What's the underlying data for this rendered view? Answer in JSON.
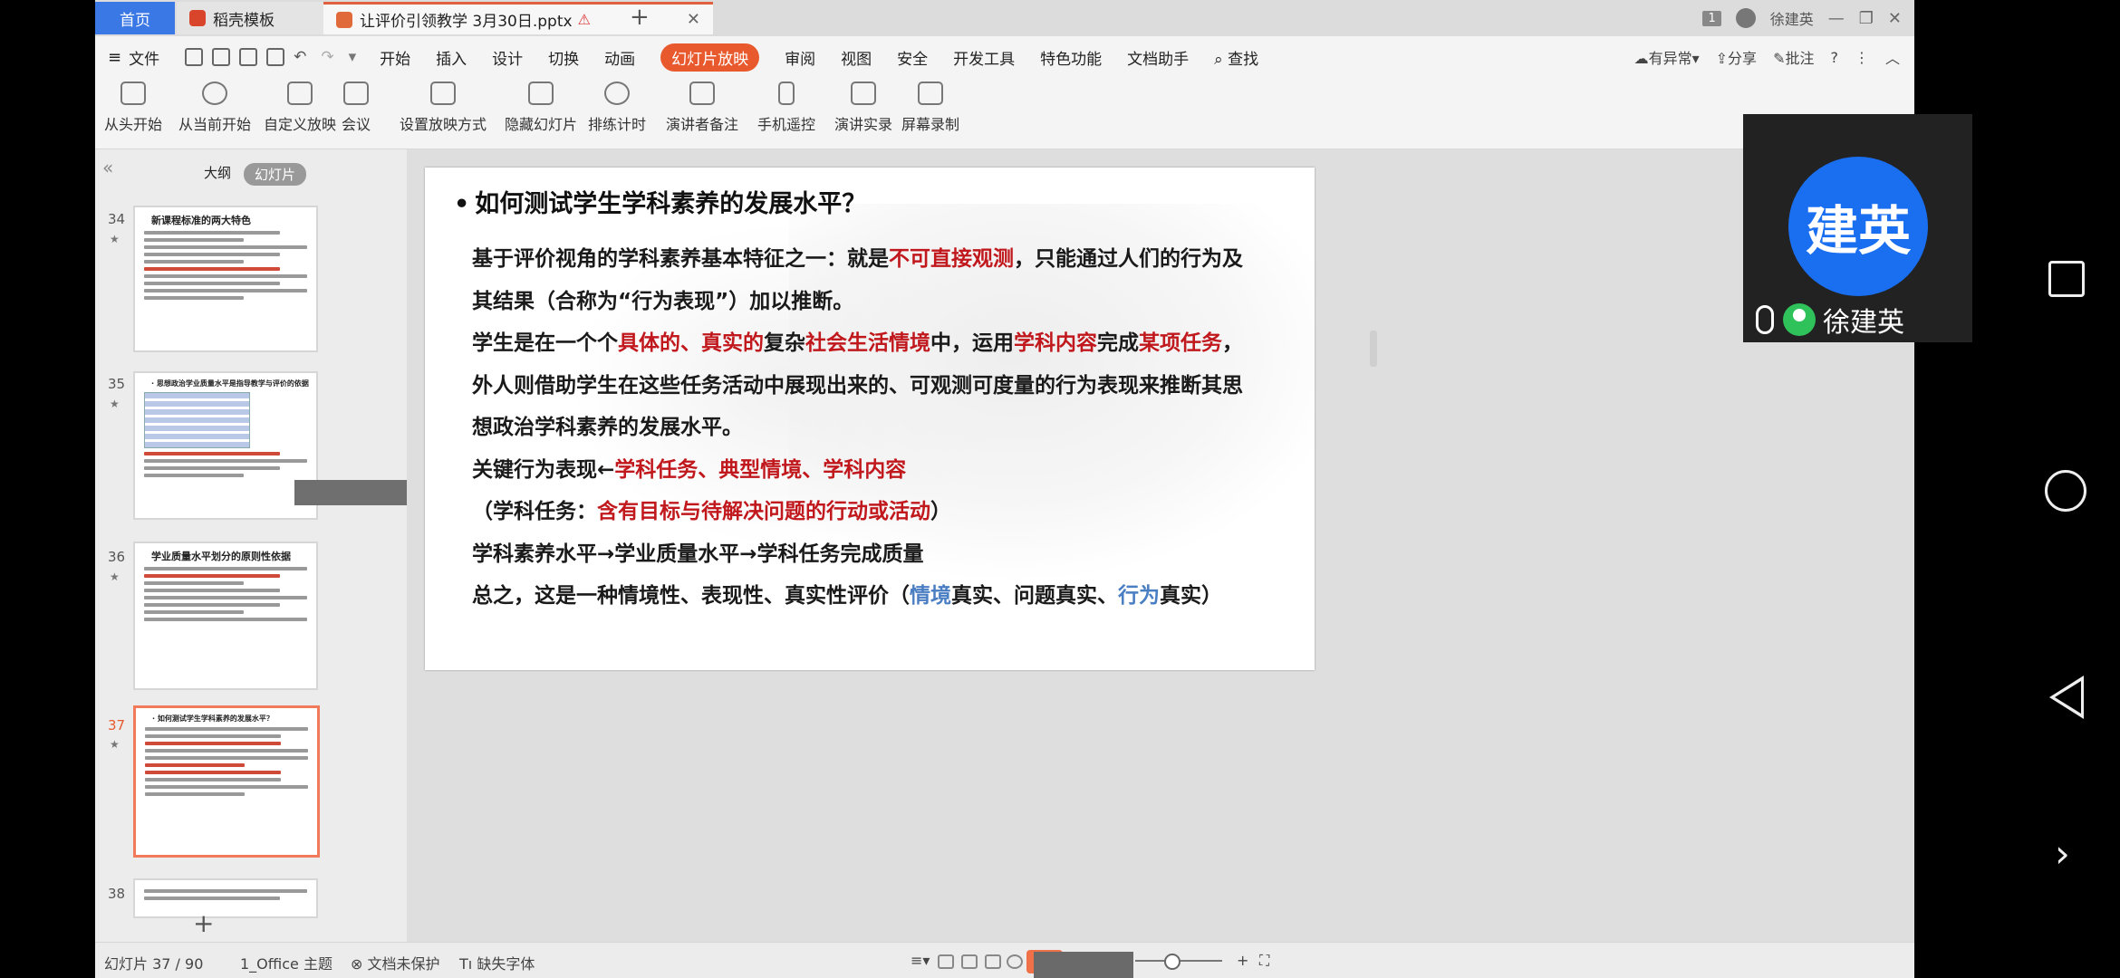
{
  "titlebar": {
    "tab_home": "首页",
    "tab_template": "稻壳模板",
    "tab_document": "让评价引领教学   3月30日.pptx",
    "warning": "⚠",
    "close": "✕",
    "new_tab": "+",
    "page_badge": "1",
    "user": "徐建英",
    "minimize": "—",
    "restore": "❐",
    "close_window": "✕"
  },
  "menu": {
    "file": "文件",
    "items": [
      "开始",
      "插入",
      "设计",
      "切换",
      "动画",
      "幻灯片放映",
      "审阅",
      "视图",
      "安全",
      "开发工具",
      "特色功能",
      "文档助手"
    ],
    "active_index": 5,
    "search": "查找",
    "right": [
      "有异常",
      "分享",
      "批注"
    ]
  },
  "ribbon": {
    "buttons": [
      "从头开始",
      "从当前开始",
      "自定义放映",
      "会议",
      "设置放映方式",
      "隐藏幻灯片",
      "排练计时",
      "演讲者备注",
      "手机遥控",
      "演讲实录",
      "屏幕录制"
    ]
  },
  "pane": {
    "tab_outline": "大纲",
    "tab_slides": "幻灯片",
    "thumbs": [
      {
        "num": "34",
        "title": "新课程标准的两大特色"
      },
      {
        "num": "35",
        "title": "· 思想政治学业质量水平是指导教学与评价的依据"
      },
      {
        "num": "36",
        "title": "学业质量水平划分的原则性依据"
      },
      {
        "num": "37",
        "title": "· 如何测试学生学科素养的发展水平？"
      },
      {
        "num": "38",
        "title": ""
      }
    ]
  },
  "slide": {
    "title": "如何测试学生学科素养的发展水平？",
    "p1a": "基于评价视角的学科素养基本特征之一：就是",
    "p1_red": "不可直接观测",
    "p1b": "，只能通过人们的行为及其结果（合称为“行为表现”）加以推断。",
    "p2a": "学生是在一个个",
    "p2_red1": "具体的、真实的",
    "p2b": "复杂",
    "p2_red2": "社会生活情境",
    "p2c": "中，运用",
    "p2_red3": "学科内容",
    "p2d": "完成",
    "p2_red4": "某项任务",
    "p2e": "，外人则借助学生在这些任务活动中展现出来的、可观测可度量的行为表现来推断其思想政治学科素养的发展水平。",
    "p3a": "关键行为表现←",
    "p3_red": "学科任务、典型情境、学科内容",
    "p4a": "（学科任务：",
    "p4_red": "含有目标与待解决问题的行动或活动",
    "p4b": "）",
    "p5": "学科素养水平→学业质量水平→学科任务完成质量",
    "p6a": "总之，这是一种情境性、表现性、真实性评价（",
    "p6_blue1": "情境",
    "p6b": "真实、问题真实、",
    "p6_blue2": "行为",
    "p6c": "真实）"
  },
  "status": {
    "slide_count": "幻灯片 37 / 90",
    "theme": "1_Office 主题",
    "protect": "文档未保护",
    "font": "缺失字体"
  },
  "video": {
    "avatar_text": "建英",
    "name": "徐建英"
  },
  "colors": {
    "accent": "#e85a2e",
    "home_tab": "#3a78e6",
    "emphasis_red": "#c0181c",
    "emphasis_blue": "#4a7ec2",
    "avatar_blue": "#1a6ef0"
  }
}
